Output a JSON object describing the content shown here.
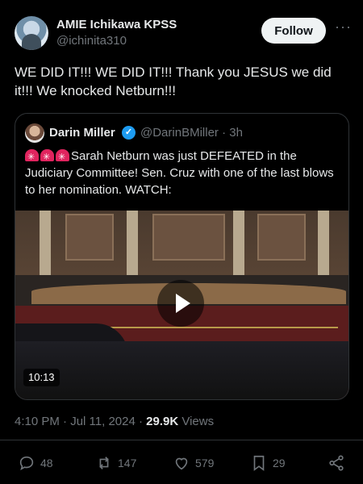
{
  "author": {
    "name": "AMIE Ichikawa KPSS",
    "handle": "@ichinita310",
    "follow_label": "Follow"
  },
  "tweet": {
    "text": "WE DID IT!!! WE DID IT!!! Thank you JESUS we did it!!! We knocked Netburn!!!"
  },
  "quoted": {
    "name": "Darin Miller",
    "handle_time": "@DarinBMiller · 3h",
    "text": "Sarah Netburn was just DEFEATED in the Judiciary Committee! Sen. Cruz with one of the last blows to her nomination. WATCH:",
    "video_duration": "10:13"
  },
  "meta": {
    "timestamp": "4:10 PM · Jul 11, 2024 · ",
    "views_count": "29.9K",
    "views_label": " Views"
  },
  "actions": {
    "replies": "48",
    "reposts": "147",
    "likes": "579",
    "bookmarks": "29"
  },
  "icons": {
    "more": "more-icon",
    "verified": "verified-badge-icon",
    "siren": "rotating-light-icon",
    "reply": "reply-icon",
    "repost": "repost-icon",
    "like": "heart-icon",
    "bookmark": "bookmark-icon",
    "share": "share-icon",
    "play": "play-icon"
  },
  "colors": {
    "background": "#000000",
    "text": "#e7e9ea",
    "muted": "#71767b",
    "verified": "#1d9bf0",
    "border": "#2f3336"
  }
}
